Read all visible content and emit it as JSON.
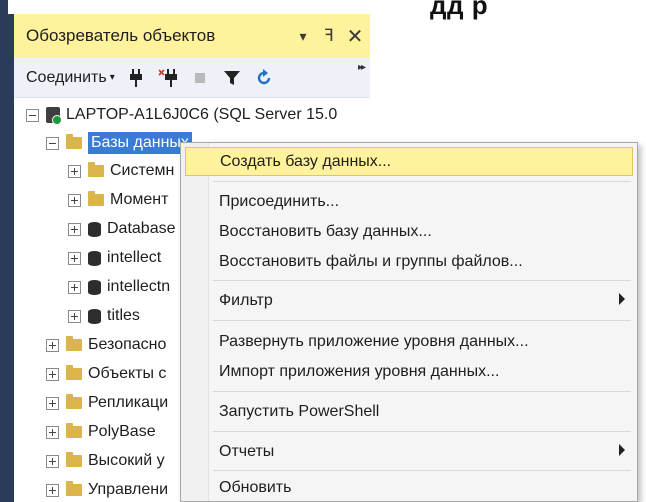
{
  "background": {
    "top_text": "дд      р"
  },
  "panel": {
    "title": "Обозреватель объектов",
    "dropdown_glyph": "▾",
    "pin_glyph": "ꟻ",
    "close_glyph": "✕"
  },
  "toolbar": {
    "connect_label": "Соединить",
    "connect_caret": "▾",
    "overflow_glyph": "▸▸"
  },
  "tree": {
    "server": "LAPTOP-A1L6J0C6 (SQL Server 15.0",
    "databases": "Базы данных",
    "items": [
      "Системн",
      "Момент",
      "Database",
      "intellect",
      "intellectn",
      "titles"
    ],
    "top_folders": [
      "Безопасно",
      "Объекты с",
      "Репликаци",
      "PolyBase",
      "Высокий у",
      "Управлени"
    ]
  },
  "context_menu": {
    "create_db": "Создать базу данных...",
    "attach": "Присоединить...",
    "restore_db": "Восстановить базу данных...",
    "restore_files": "Восстановить файлы и группы файлов...",
    "filter": "Фильтр",
    "deploy_app": "Развернуть приложение уровня данных...",
    "import_app": "Импорт приложения уровня данных...",
    "powershell": "Запустить PowerShell",
    "reports": "Отчеты",
    "refresh": "Обновить"
  },
  "colors": {
    "highlight": "#fff29d",
    "selection": "#3a7bd5",
    "panel_frame": "#2b3b5a"
  }
}
